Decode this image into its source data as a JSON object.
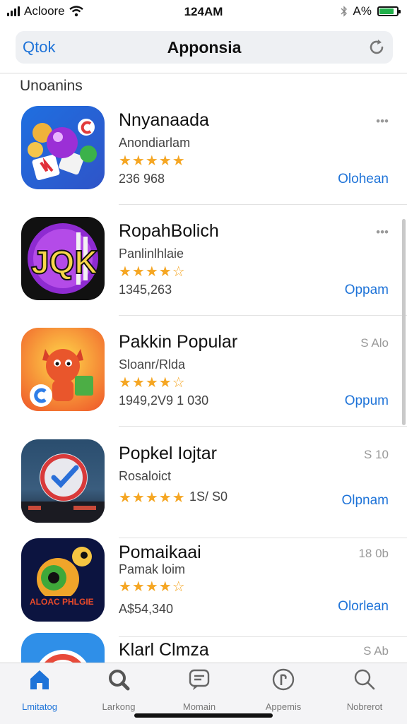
{
  "status_bar": {
    "carrier": "Acloore",
    "time": "124AM",
    "battery": "A%",
    "battery_level": 0.85
  },
  "nav": {
    "back_label": "Qtok",
    "title": "Apponsia"
  },
  "section_title": "Unoanins",
  "apps": [
    {
      "name": "Nnyanaada",
      "subtitle": "Anondiarlam",
      "rating": 5,
      "count": "236 968",
      "meta": "•••",
      "action": "Olohean",
      "icon": "puzzle-candy-icon"
    },
    {
      "name": "RopahBolich",
      "subtitle": "Panlinlhlaie",
      "rating": 4.5,
      "count": "1345,263",
      "meta": "•••",
      "action": "Oppam",
      "icon": "jqk-card-icon"
    },
    {
      "name": "Pakkin Popular",
      "subtitle": "Sloanr/Rlda",
      "rating": 4.5,
      "count": "1949,2V9 1 030",
      "meta": "S Alo",
      "action": "Oppum",
      "icon": "red-fox-icon"
    },
    {
      "name": "Popkel Iojtar",
      "subtitle": "Rosaloict",
      "rating": 5,
      "count": "1S/ S0",
      "meta": "S 10",
      "action": "Olpnam",
      "icon": "checkmark-circle-icon"
    },
    {
      "name": "Pomaikaai",
      "subtitle": "Pamak loim",
      "rating": 4.5,
      "count": "A$54,340",
      "meta": "18 0b",
      "action": "Olorlean",
      "icon": "green-creature-icon"
    },
    {
      "name": "Klarl Clmza",
      "subtitle": "",
      "rating": 0,
      "count": "",
      "meta": "S Ab",
      "action": "",
      "icon": "blue-ring-icon"
    }
  ],
  "tabs": [
    {
      "label": "Lmitatog",
      "icon": "home-icon",
      "active": true
    },
    {
      "label": "Larkong",
      "icon": "search-icon",
      "active": false
    },
    {
      "label": "Momain",
      "icon": "message-icon",
      "active": false
    },
    {
      "label": "Appemis",
      "icon": "apps-icon",
      "active": false
    },
    {
      "label": "Nobrerot",
      "icon": "magnifier-icon",
      "active": false
    }
  ],
  "colors": {
    "accent": "#1e73d8",
    "star": "#f5a623"
  }
}
